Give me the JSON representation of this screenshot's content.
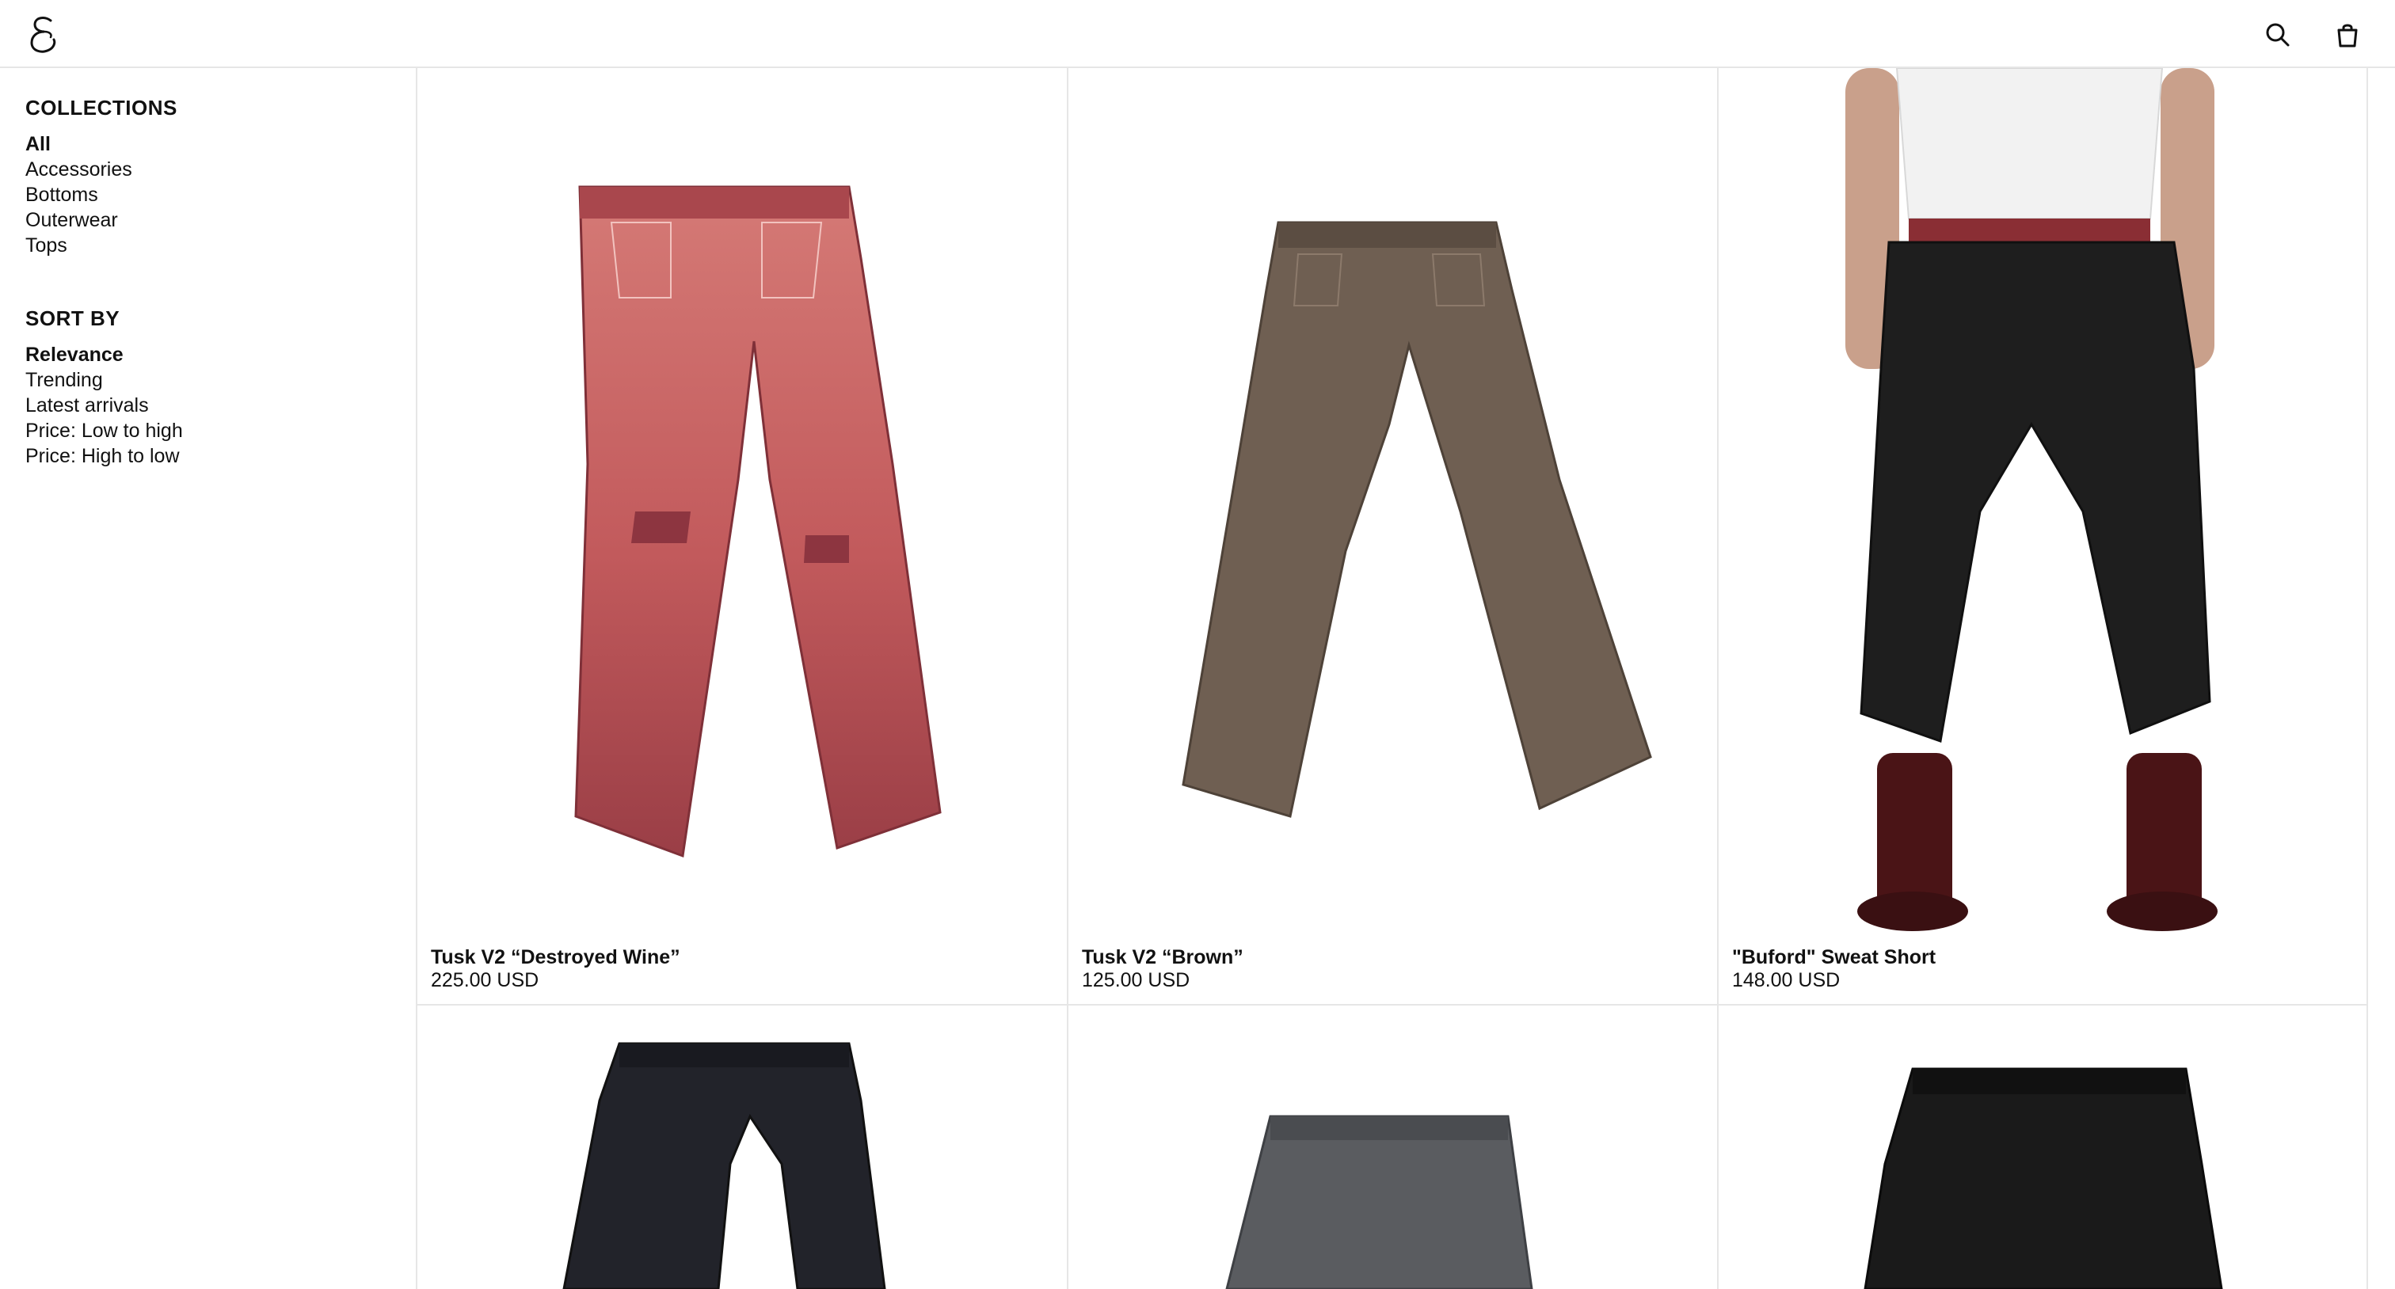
{
  "header": {
    "logo_icon": "script-e-logo",
    "search_icon": "search-icon",
    "cart_icon": "shopping-bag-icon"
  },
  "sidebar": {
    "collections_heading": "COLLECTIONS",
    "collections": [
      {
        "label": "All",
        "active": true
      },
      {
        "label": "Accessories",
        "active": false
      },
      {
        "label": "Bottoms",
        "active": false
      },
      {
        "label": "Outerwear",
        "active": false
      },
      {
        "label": "Tops",
        "active": false
      }
    ],
    "sort_heading": "SORT BY",
    "sort_options": [
      {
        "label": "Relevance",
        "active": true
      },
      {
        "label": "Trending",
        "active": false
      },
      {
        "label": "Latest arrivals",
        "active": false
      },
      {
        "label": "Price: Low to high",
        "active": false
      },
      {
        "label": "Price: High to low",
        "active": false
      }
    ]
  },
  "products": [
    {
      "title": "Tusk V2 “Destroyed Wine”",
      "price": "225.00 USD",
      "color": "#b85a5a"
    },
    {
      "title": "Tusk V2 “Brown”",
      "price": "125.00 USD",
      "color": "#6f5f52"
    },
    {
      "title": "\"Buford\" Sweat Short",
      "price": "148.00 USD",
      "color": "#1e1e1e"
    },
    {
      "title": "",
      "price": "",
      "color": "#22232a"
    },
    {
      "title": "",
      "price": "",
      "color": "#5a5c60"
    },
    {
      "title": "",
      "price": "",
      "color": "#1a1a1a"
    }
  ]
}
